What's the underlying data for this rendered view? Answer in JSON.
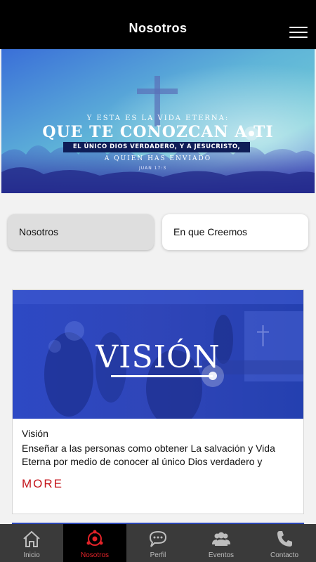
{
  "header": {
    "title": "Nosotros",
    "menu_icon": "hamburger-menu-icon"
  },
  "banner": {
    "line1": "Y ESTA ES LA VIDA ETERNA:",
    "line2": "QUE TE CONOZCAN A TI",
    "line3": "EL ÚNICO DIOS VERDADERO, Y A JESUCRISTO,",
    "line4": "A QUIEN HAS ENVIADO",
    "reference": "JUAN 17:3"
  },
  "tabs": [
    {
      "label": "Nosotros",
      "selected": true
    },
    {
      "label": "En que Creemos",
      "selected": false
    }
  ],
  "card": {
    "image_word": "VISIÓN",
    "title": "Visión",
    "description": "Enseñar a las personas como obtener La salvación y Vida Eterna por medio de conocer al único Dios verdadero y",
    "more_label": "MORE"
  },
  "tabbar": {
    "items": [
      {
        "label": "Inicio",
        "icon": "home-icon"
      },
      {
        "label": "Nosotros",
        "icon": "network-icon",
        "active": true
      },
      {
        "label": "Perfil",
        "icon": "chat-icon"
      },
      {
        "label": "Eventos",
        "icon": "people-icon"
      },
      {
        "label": "Contacto",
        "icon": "phone-icon"
      }
    ]
  },
  "colors": {
    "header_bg": "#000000",
    "accent": "#e32329",
    "more_red": "#c4161c",
    "tabbar_bg": "#3a3a3a"
  }
}
